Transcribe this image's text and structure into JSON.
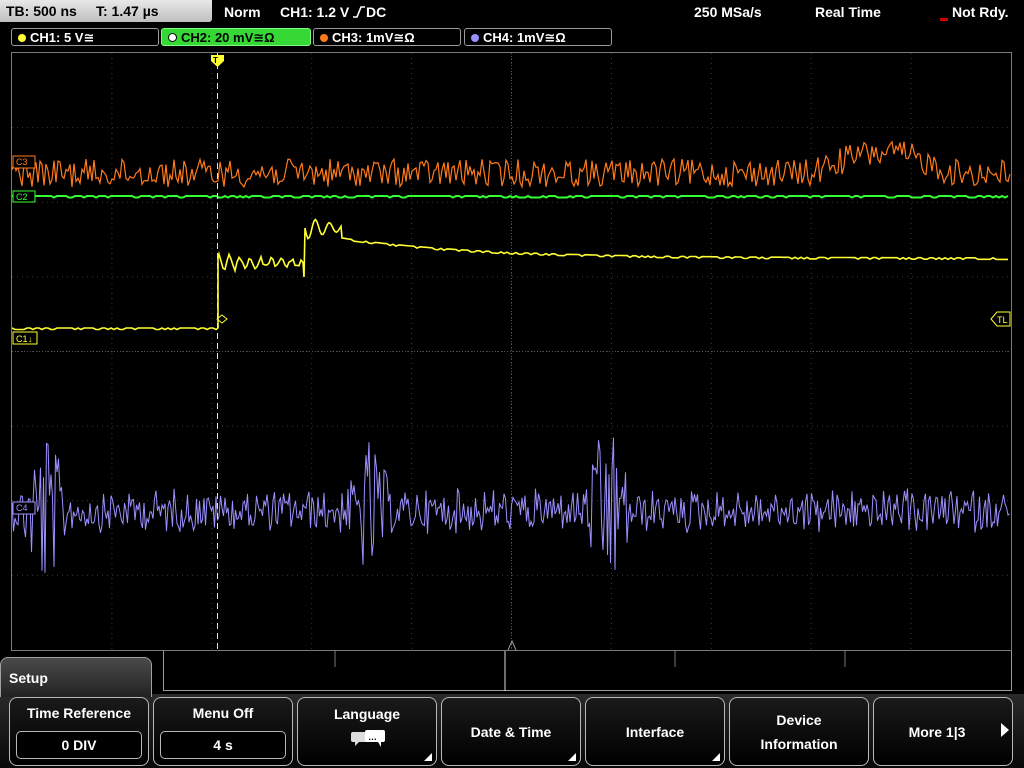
{
  "status": {
    "timebase": "TB: 500 ns",
    "trigger_time": "T: 1.47 µs",
    "trigger_mode": "Norm",
    "trigger_source": "CH1: 1.2 V",
    "trigger_coupling": "DC",
    "sample_rate": "250 MSa/s",
    "acq_mode": "Real Time",
    "acq_state": "Not Rdy."
  },
  "channels": [
    {
      "label": "CH1: 5 V≅",
      "color": "#ffff33"
    },
    {
      "label": "CH2: 20 mV≅Ω",
      "color": "#33ff33"
    },
    {
      "label": "CH3: 1mV≅Ω",
      "color": "#ff7a1a"
    },
    {
      "label": "CH4: 1mV≅Ω",
      "color": "#9a90ff"
    }
  ],
  "markers": {
    "c1": "C1",
    "c2": "C2",
    "c3": "C3",
    "c4": "C4",
    "trigger_level": "TL",
    "trigger_pos": "T"
  },
  "menu": {
    "title": "Setup",
    "time_reference_label": "Time Reference",
    "time_reference_value": "0 DIV",
    "menu_off_label": "Menu Off",
    "menu_off_value": "4 s",
    "language_label": "Language",
    "date_time_label": "Date & Time",
    "interface_label": "Interface",
    "device_info_line1": "Device",
    "device_info_line2": "Information",
    "more_label": "More 1|3"
  },
  "icons": {
    "language": "speech-bubbles-icon",
    "more": "arrow-right-icon"
  }
}
